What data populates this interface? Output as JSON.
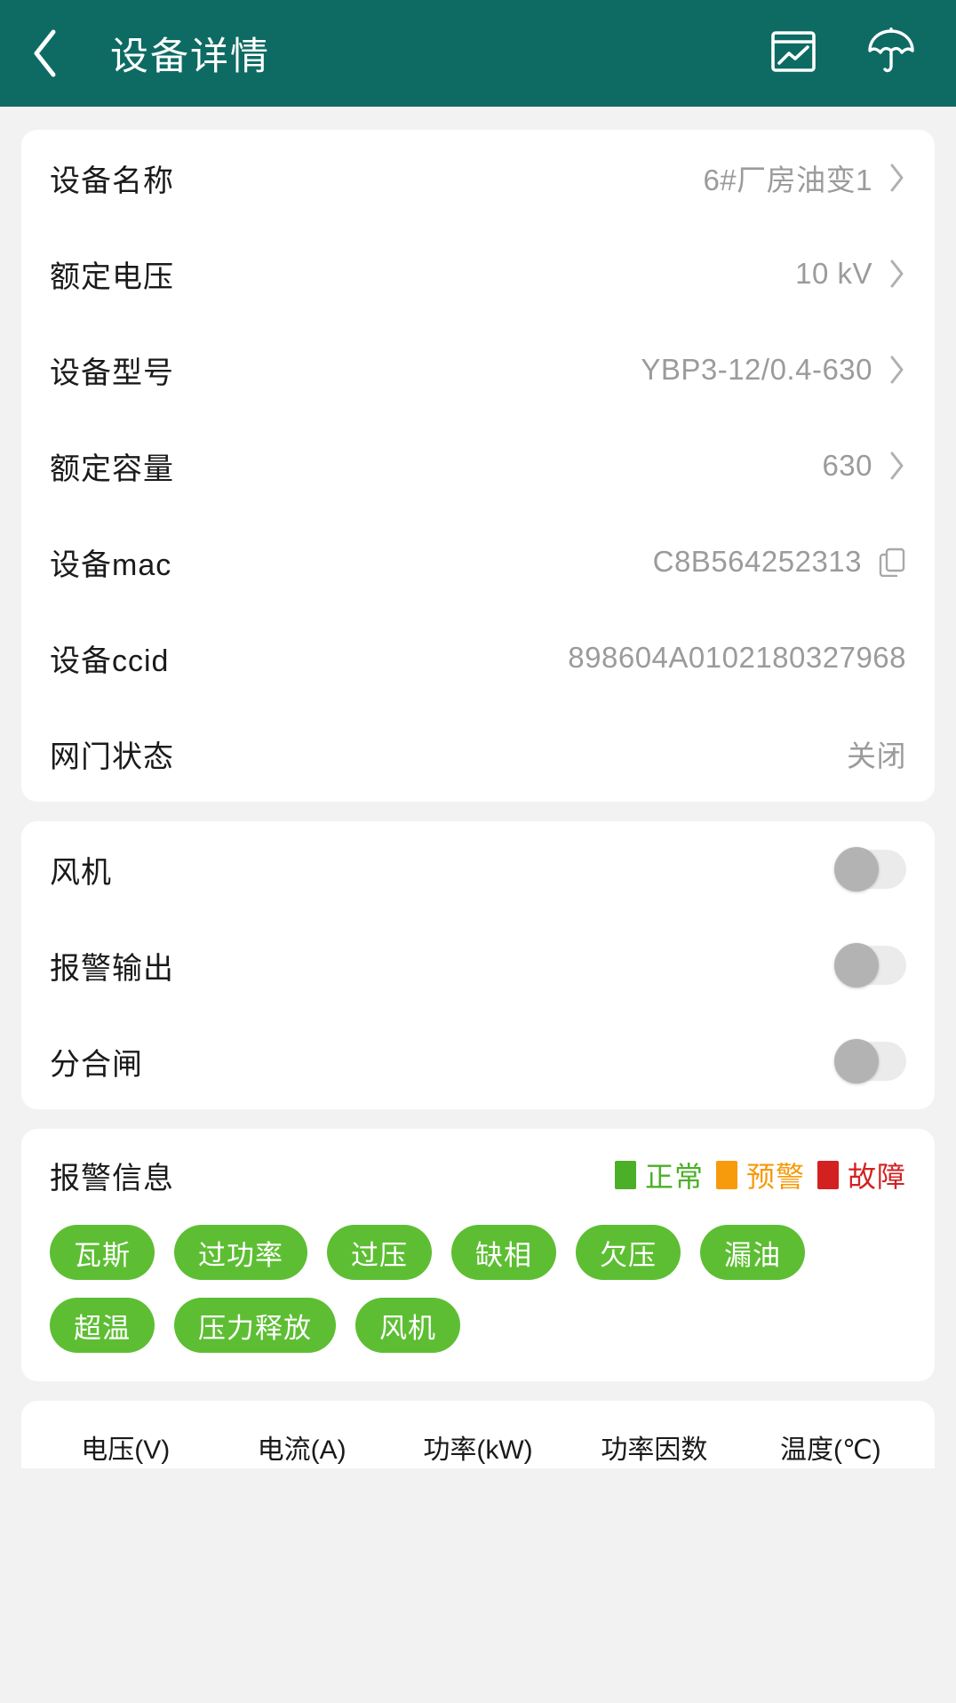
{
  "header": {
    "title": "设备详情",
    "back_icon": "chevron-left-icon",
    "chart_icon": "chart-window-icon",
    "umbrella_icon": "umbrella-icon",
    "bg_color": "#0d6b63"
  },
  "info_card": {
    "rows": [
      {
        "label": "设备名称",
        "value": "6#厂房油变1",
        "affordance": "chevron"
      },
      {
        "label": "额定电压",
        "value": "10 kV",
        "affordance": "chevron"
      },
      {
        "label": "设备型号",
        "value": "YBP3-12/0.4-630",
        "affordance": "chevron"
      },
      {
        "label": "额定容量",
        "value": "630",
        "affordance": "chevron"
      },
      {
        "label": "设备mac",
        "value": "C8B564252313",
        "affordance": "copy"
      },
      {
        "label": "设备ccid",
        "value": "898604A0102180327968",
        "affordance": "none"
      },
      {
        "label": "网门状态",
        "value": "关闭",
        "affordance": "none"
      }
    ]
  },
  "switch_card": {
    "rows": [
      {
        "label": "风机",
        "on": false
      },
      {
        "label": "报警输出",
        "on": false
      },
      {
        "label": "分合闸",
        "on": false
      }
    ]
  },
  "alarm_card": {
    "title": "报警信息",
    "legend": [
      {
        "label": "正常",
        "color": "#4caf28"
      },
      {
        "label": "预警",
        "color": "#f79a0b"
      },
      {
        "label": "故障",
        "color": "#d32121"
      }
    ],
    "tags": [
      {
        "label": "瓦斯",
        "status": "正常",
        "color": "#5dbe33"
      },
      {
        "label": "过功率",
        "status": "正常",
        "color": "#5dbe33"
      },
      {
        "label": "过压",
        "status": "正常",
        "color": "#5dbe33"
      },
      {
        "label": "缺相",
        "status": "正常",
        "color": "#5dbe33"
      },
      {
        "label": "欠压",
        "status": "正常",
        "color": "#5dbe33"
      },
      {
        "label": "漏油",
        "status": "正常",
        "color": "#5dbe33"
      },
      {
        "label": "超温",
        "status": "正常",
        "color": "#5dbe33"
      },
      {
        "label": "压力释放",
        "status": "正常",
        "color": "#5dbe33"
      },
      {
        "label": "风机",
        "status": "正常",
        "color": "#5dbe33"
      }
    ]
  },
  "metrics_card": {
    "columns": [
      {
        "label": "电压(V)"
      },
      {
        "label": "电流(A)"
      },
      {
        "label": "功率(kW)"
      },
      {
        "label": "功率因数"
      },
      {
        "label": "温度(℃)"
      }
    ]
  }
}
